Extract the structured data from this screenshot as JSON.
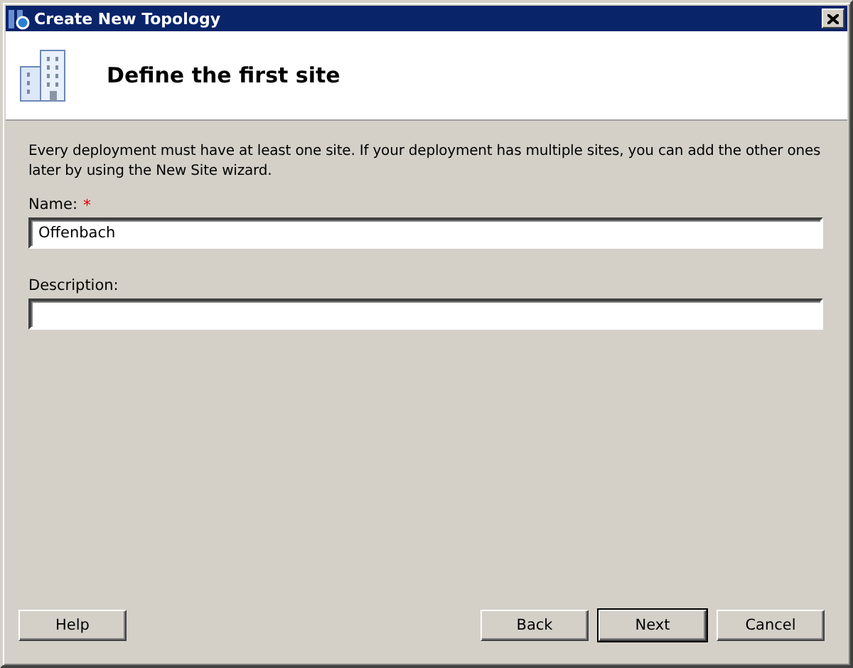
{
  "window": {
    "title": "Create New Topology"
  },
  "header": {
    "title": "Define the first site"
  },
  "intro": "Every deployment must have at least one site. If your deployment has multiple sites, you can add the other ones later by using the New Site wizard.",
  "fields": [
    {
      "label": "Name:",
      "required_mark": "*",
      "value": "Offenbach"
    },
    {
      "label": "Description:"
    }
  ],
  "buttons": [
    {
      "label": "Help",
      "default": false
    },
    {
      "label": "Back",
      "default": false
    },
    {
      "label": "Next",
      "default": true
    },
    {
      "label": "Cancel",
      "default": false
    }
  ]
}
